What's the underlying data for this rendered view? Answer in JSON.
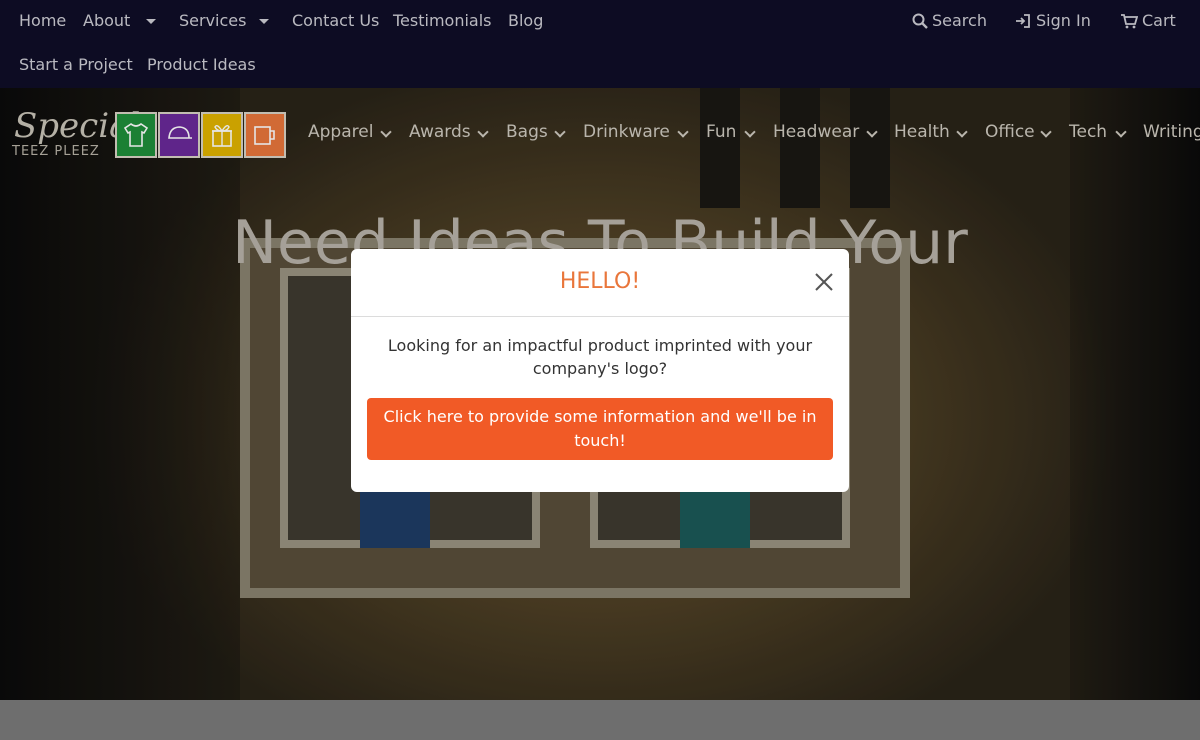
{
  "topnav": {
    "links": [
      {
        "label": "Home"
      },
      {
        "label": "About"
      },
      {
        "label": "Services"
      },
      {
        "label": "Contact Us"
      },
      {
        "label": "Testimonials"
      },
      {
        "label": "Blog"
      },
      {
        "label": "Start a Project"
      },
      {
        "label": "Product Ideas"
      }
    ],
    "search_label": "Search",
    "signin_label": "Sign In",
    "cart_label": "Cart"
  },
  "logo": {
    "script_text": "Special",
    "sub_text": "TEEZ PLEEZ",
    "tiles": [
      {
        "icon": "tshirt-icon",
        "color": "#1f8f3a"
      },
      {
        "icon": "cap-icon",
        "color": "#6a2a9a"
      },
      {
        "icon": "gift-icon",
        "color": "#e1b400"
      },
      {
        "icon": "mug-icon",
        "color": "#e9763b"
      }
    ]
  },
  "categories": [
    {
      "label": "Apparel"
    },
    {
      "label": "Awards"
    },
    {
      "label": "Bags"
    },
    {
      "label": "Drinkware"
    },
    {
      "label": "Fun"
    },
    {
      "label": "Headwear"
    },
    {
      "label": "Health"
    },
    {
      "label": "Office"
    },
    {
      "label": "Tech"
    },
    {
      "label": "Writing"
    }
  ],
  "hero": {
    "headline": "Need Ideas To Build Your"
  },
  "modal": {
    "title": "HELLO!",
    "message": "Looking for an impactful product imprinted with your company's logo?",
    "cta_label": "Click here to provide some information and we'll be in touch!"
  },
  "colors": {
    "topbar_bg": "#0f0e27",
    "accent_orange": "#f15a26",
    "title_orange": "#e9763b"
  }
}
